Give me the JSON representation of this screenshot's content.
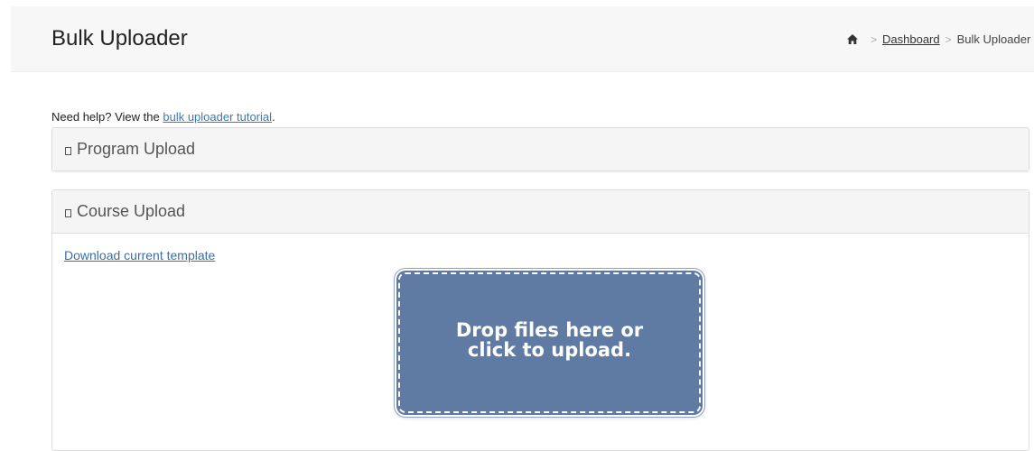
{
  "header": {
    "title": "Bulk Uploader",
    "breadcrumb": {
      "home_icon": "home-icon",
      "items": [
        "Dashboard",
        "Bulk Uploader"
      ]
    }
  },
  "help": {
    "prefix": "Need help? View the ",
    "link_text": "bulk uploader tutorial",
    "suffix": "."
  },
  "panels": {
    "program": {
      "icon": "glyph-box-icon",
      "title": "Program Upload"
    },
    "course": {
      "icon": "glyph-box-icon",
      "title": "Course Upload",
      "download_link": "Download current template",
      "dropzone": {
        "line1": "Drop files here or",
        "line2": "click to upload.",
        "color": "#5f7aa3"
      }
    }
  },
  "colors": {
    "header_bg": "#f7f7f7",
    "link": "#3a7ab8",
    "panel_heading_bg": "#f5f5f5"
  }
}
